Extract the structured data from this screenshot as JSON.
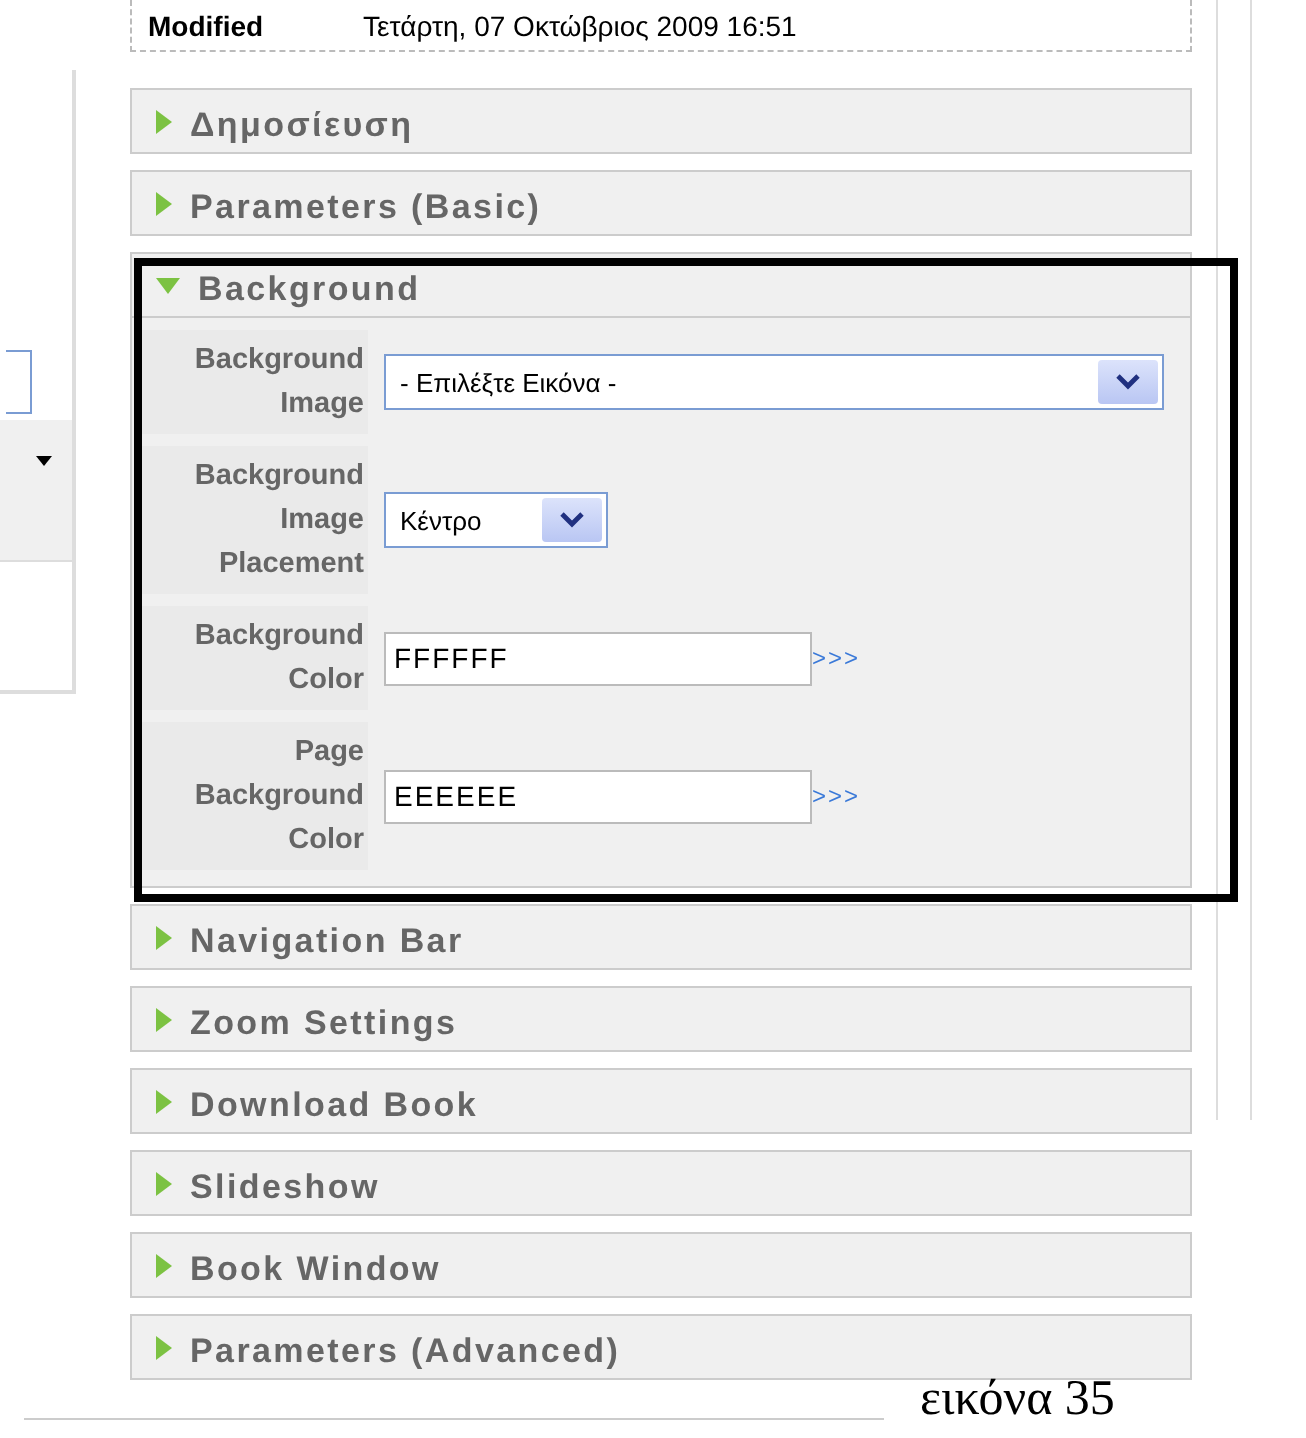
{
  "info_row": {
    "label": "Modified",
    "value": "Τετάρτη, 07 Οκτώβριος 2009 16:51"
  },
  "sections": [
    {
      "title": "Δημοσίευση",
      "expanded": false
    },
    {
      "title": "Parameters (Basic)",
      "expanded": false
    },
    {
      "title": "Background",
      "expanded": true,
      "highlighted": true,
      "fields": [
        {
          "label": "Background Image",
          "kind": "select",
          "value": "- Επιλέξτε Εικόνα -"
        },
        {
          "label": "Background Image Placement",
          "kind": "compact-select",
          "value": "Κέντρο"
        },
        {
          "label": "Background Color",
          "kind": "text",
          "value": "FFFFFF",
          "link": ">>>"
        },
        {
          "label": "Page Background Color",
          "kind": "text",
          "value": "EEEEEE",
          "link": ">>>"
        }
      ]
    },
    {
      "title": "Navigation Bar",
      "expanded": false
    },
    {
      "title": "Zoom Settings",
      "expanded": false
    },
    {
      "title": "Download Book",
      "expanded": false
    },
    {
      "title": "Slideshow",
      "expanded": false
    },
    {
      "title": "Book Window",
      "expanded": false
    },
    {
      "title": "Parameters (Advanced)",
      "expanded": false
    }
  ],
  "caption": "εικόνα 35"
}
